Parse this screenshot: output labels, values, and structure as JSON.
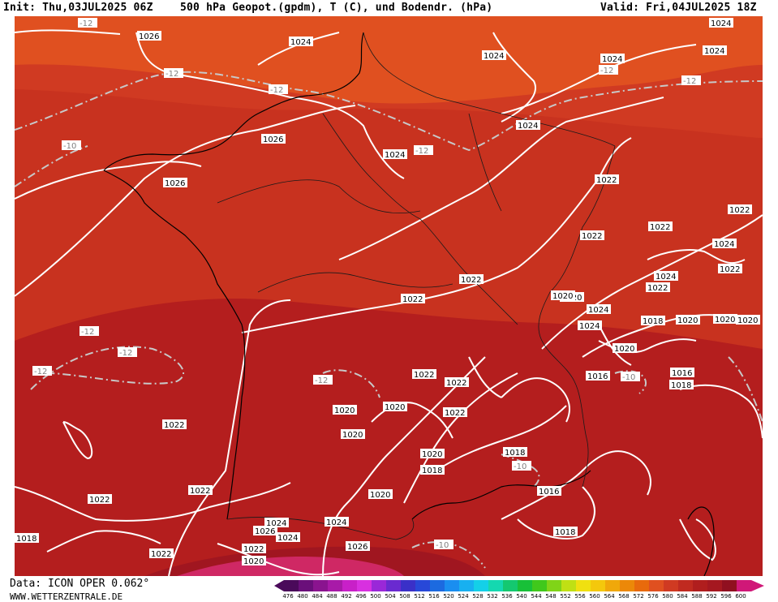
{
  "header": {
    "init": "Init: Thu,03JUL2025 06Z",
    "title": "500 hPa Geopot.(gpdm), T (C), und Bodendr. (hPa)",
    "valid": "Valid: Fri,04JUL2025 18Z"
  },
  "footer": {
    "source": "Data: ICON OPER 0.062°",
    "website": "WWW.WETTERZENTRALE.DE"
  },
  "colors": {
    "band_1": "#e05020",
    "band_2": "#d03a22",
    "band_3": "#c02a20",
    "band_4": "#b01e1e",
    "band_5": "#a51820",
    "isobar": "#ffffff",
    "temp_line": "#c8c8c8",
    "coast": "#000000"
  },
  "legend": {
    "ticks": [
      "476",
      "480",
      "484",
      "488",
      "492",
      "496",
      "500",
      "504",
      "508",
      "512",
      "516",
      "520",
      "524",
      "528",
      "532",
      "536",
      "540",
      "544",
      "548",
      "552",
      "556",
      "560",
      "564",
      "568",
      "572",
      "576",
      "580",
      "584",
      "588",
      "592",
      "596",
      "600"
    ],
    "colors": [
      "#4a0a5a",
      "#6a0f7a",
      "#8a148f",
      "#a81aa8",
      "#c820c8",
      "#d830e0",
      "#9a28d8",
      "#6a2ad0",
      "#3a30c8",
      "#2848d8",
      "#1c6ae0",
      "#1a8ef0",
      "#18b0f0",
      "#14d0e8",
      "#14d8b0",
      "#14c870",
      "#18c038",
      "#40c81c",
      "#80d418",
      "#c0e014",
      "#f0e010",
      "#f4c80c",
      "#f0a80a",
      "#ec8808",
      "#e86a0c",
      "#e05020",
      "#d03a22",
      "#c02a20",
      "#b01e1e",
      "#a51820",
      "#901020",
      "#d01878"
    ]
  },
  "isobar_labels": [
    "1026",
    "1024",
    "1024",
    "1024",
    "1024",
    "1024",
    "1026",
    "1024",
    "1026",
    "1022",
    "1024",
    "1022",
    "1022",
    "1022",
    "1024",
    "1024",
    "1022",
    "1022",
    "1020",
    "1024",
    "1024",
    "1018",
    "1020",
    "1020",
    "1022",
    "1022",
    "1020",
    "1016",
    "1018",
    "1020",
    "1020",
    "1022",
    "1022",
    "1022",
    "1020",
    "1018",
    "1020",
    "1020",
    "1018",
    "1022",
    "1016",
    "1018",
    "1020",
    "1022",
    "1022",
    "1024",
    "1016",
    "1020",
    "1024",
    "1026",
    "1022",
    "1020",
    "1018",
    "1022",
    "1026",
    "1024"
  ],
  "temp_labels": [
    "-12",
    "-12",
    "-12",
    "-12",
    "-12",
    "-10",
    "-12",
    "-12",
    "-12",
    "-12",
    "-12",
    "-10",
    "-10",
    "-10"
  ]
}
